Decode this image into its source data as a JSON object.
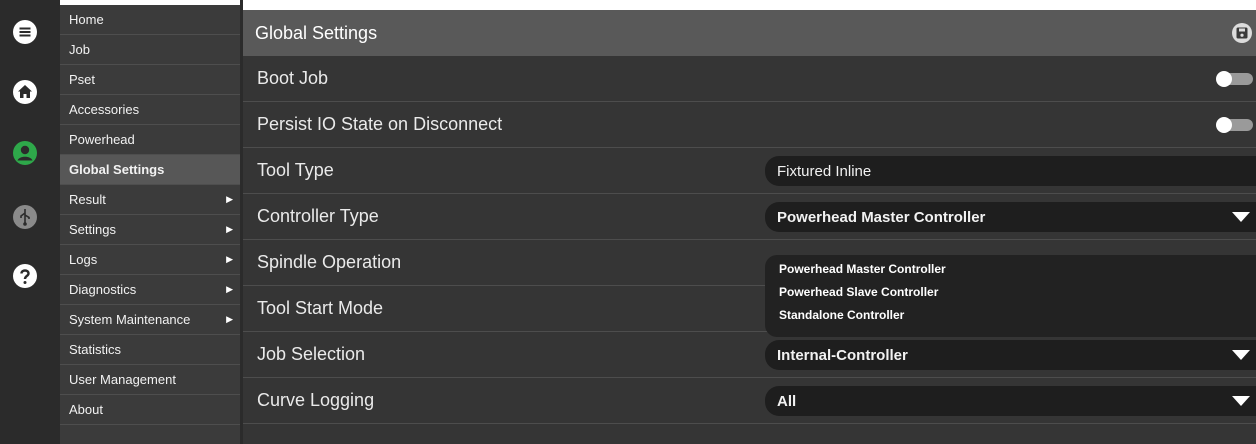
{
  "rail": {
    "icons": [
      "menu-icon",
      "home-icon",
      "user-icon",
      "usb-icon",
      "help-icon"
    ]
  },
  "menu": {
    "items": [
      {
        "label": "Home",
        "arrow": false,
        "active": false
      },
      {
        "label": "Job",
        "arrow": false,
        "active": false
      },
      {
        "label": "Pset",
        "arrow": false,
        "active": false
      },
      {
        "label": "Accessories",
        "arrow": false,
        "active": false
      },
      {
        "label": "Powerhead",
        "arrow": false,
        "active": false
      },
      {
        "label": "Global Settings",
        "arrow": false,
        "active": true
      },
      {
        "label": "Result",
        "arrow": true,
        "active": false
      },
      {
        "label": "Settings",
        "arrow": true,
        "active": false
      },
      {
        "label": "Logs",
        "arrow": true,
        "active": false
      },
      {
        "label": "Diagnostics",
        "arrow": true,
        "active": false
      },
      {
        "label": "System Maintenance",
        "arrow": true,
        "active": false
      },
      {
        "label": "Statistics",
        "arrow": false,
        "active": false
      },
      {
        "label": "User Management",
        "arrow": false,
        "active": false
      },
      {
        "label": "About",
        "arrow": false,
        "active": false
      }
    ],
    "arrow_glyph": "▶"
  },
  "panel": {
    "title": "Global Settings",
    "rows": {
      "boot_job": {
        "label": "Boot Job",
        "enabled": false
      },
      "persist_io": {
        "label": "Persist IO State on Disconnect",
        "enabled": false
      },
      "tool_type": {
        "label": "Tool Type",
        "value": "Fixtured Inline"
      },
      "controller_type": {
        "label": "Controller Type",
        "value": "Powerhead Master Controller"
      },
      "spindle_operation": {
        "label": "Spindle Operation"
      },
      "tool_start_mode": {
        "label": "Tool Start Mode"
      },
      "job_selection": {
        "label": "Job Selection",
        "value": "Internal-Controller"
      },
      "curve_logging": {
        "label": "Curve Logging",
        "value": "All"
      }
    },
    "controller_dropdown_options": [
      "Powerhead Master Controller",
      "Powerhead Slave Controller",
      "Standalone Controller"
    ]
  },
  "colors": {
    "rail_bg": "#2b2b2b",
    "menu_bg": "#3b3b3b",
    "menu_active": "#575757",
    "panel_bg": "#353535",
    "header_bg": "#595959",
    "user_icon": "#2ea84a"
  }
}
